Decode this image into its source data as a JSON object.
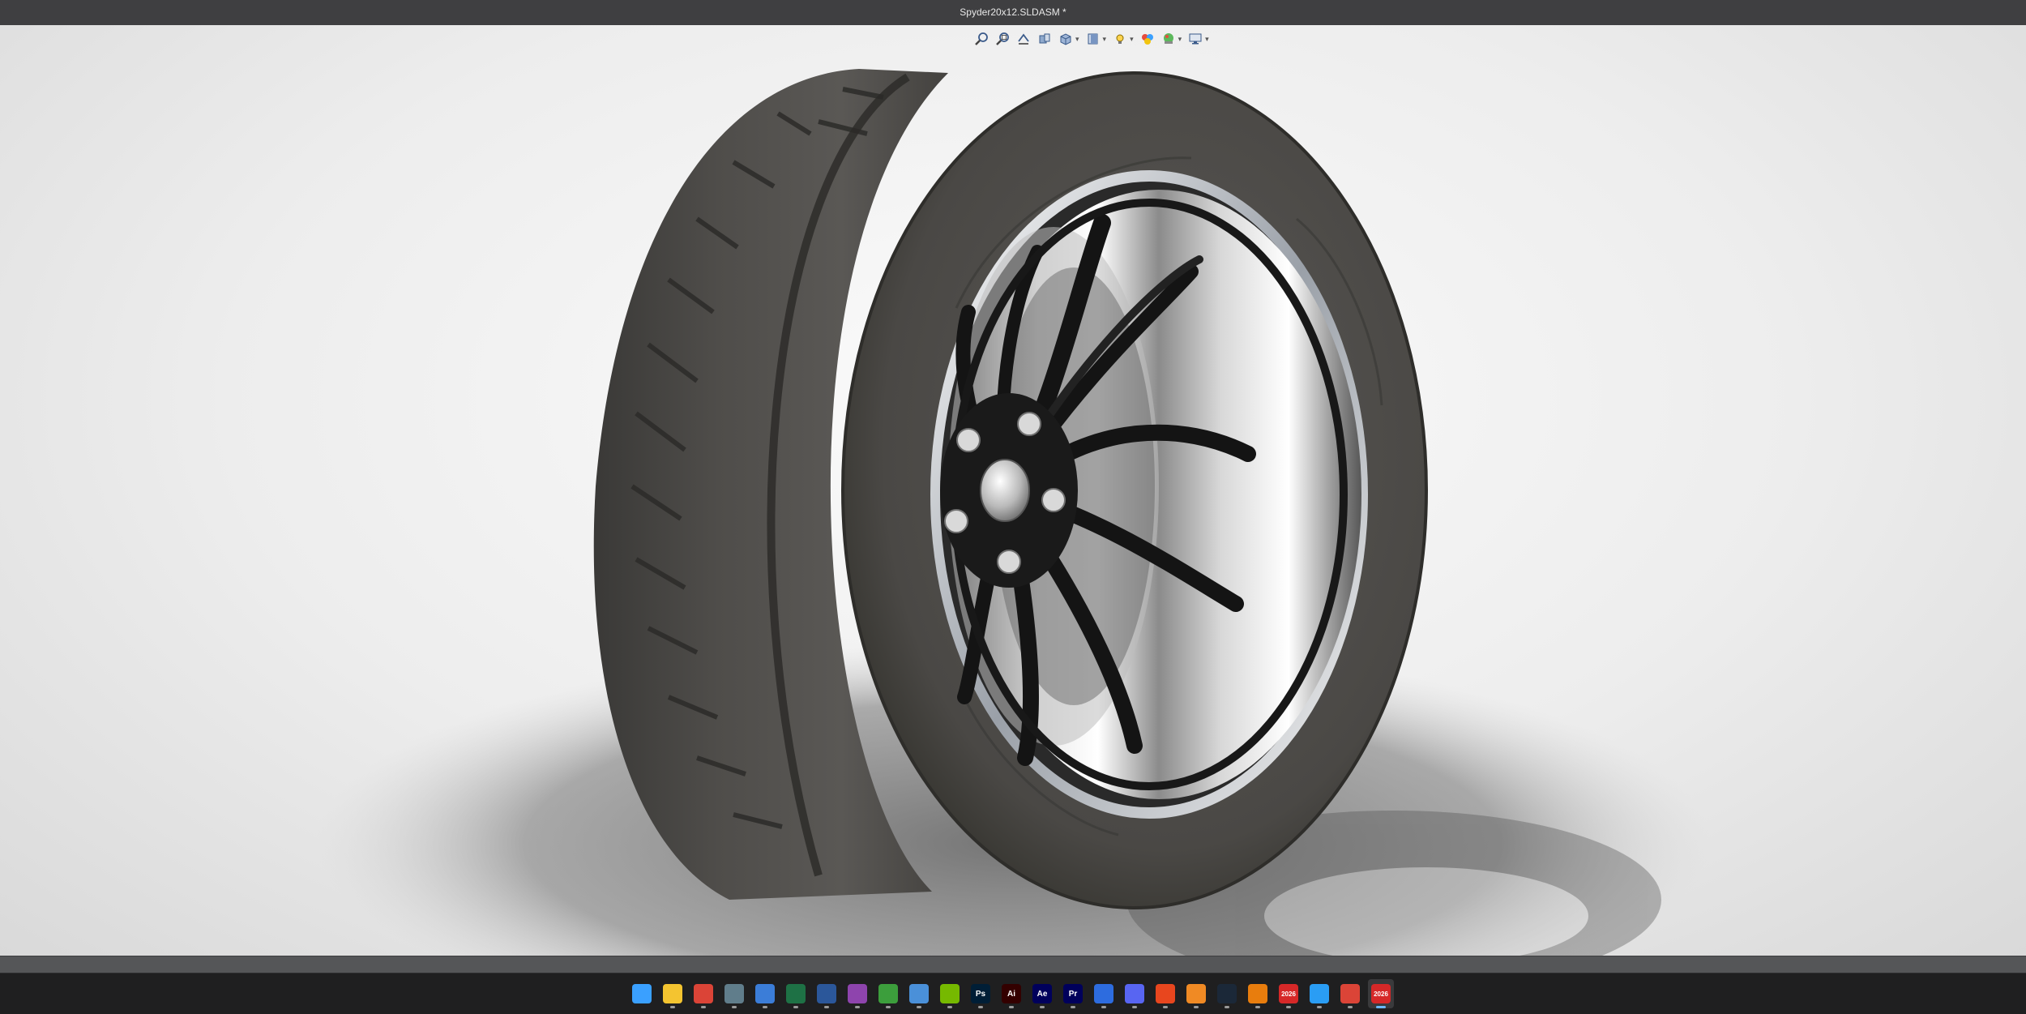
{
  "window": {
    "title": "Spyder20x12.SLDASM *"
  },
  "viewport": {
    "model_description": "3D rendered wheel assembly",
    "hud_tools": [
      {
        "name": "zoom-to-fit-icon",
        "has_dropdown": false
      },
      {
        "name": "zoom-to-area-icon",
        "has_dropdown": false
      },
      {
        "name": "previous-view-icon",
        "has_dropdown": false
      },
      {
        "name": "section-view-icon",
        "has_dropdown": false
      },
      {
        "name": "view-orientation-icon",
        "has_dropdown": true
      },
      {
        "name": "display-style-icon",
        "has_dropdown": true
      },
      {
        "name": "hide-show-items-icon",
        "has_dropdown": true
      },
      {
        "name": "edit-appearance-icon",
        "has_dropdown": false
      },
      {
        "name": "apply-scene-icon",
        "has_dropdown": true
      },
      {
        "name": "view-settings-icon",
        "has_dropdown": true
      }
    ]
  },
  "taskbar": {
    "apps": [
      {
        "name": "windows-start-icon",
        "color": "#3aa0ff",
        "label": ""
      },
      {
        "name": "file-explorer-icon",
        "color": "#f4c430",
        "label": ""
      },
      {
        "name": "chrome-icon",
        "color": "#db4437",
        "label": ""
      },
      {
        "name": "calculator-icon",
        "color": "#607d8b",
        "label": ""
      },
      {
        "name": "calendar-icon",
        "color": "#3b7dd8",
        "label": ""
      },
      {
        "name": "excel-icon",
        "color": "#1e7145",
        "label": ""
      },
      {
        "name": "word-icon",
        "color": "#2b579a",
        "label": ""
      },
      {
        "name": "screen-recorder-icon",
        "color": "#8e44ad",
        "label": ""
      },
      {
        "name": "xbox-icon",
        "color": "#3c9e3c",
        "label": ""
      },
      {
        "name": "phone-link-icon",
        "color": "#4a90d9",
        "label": ""
      },
      {
        "name": "nvidia-icon",
        "color": "#76b900",
        "label": ""
      },
      {
        "name": "photoshop-icon",
        "color": "#001e36",
        "label": "Ps"
      },
      {
        "name": "illustrator-icon",
        "color": "#330000",
        "label": "Ai"
      },
      {
        "name": "after-effects-icon",
        "color": "#00005b",
        "label": "Ae"
      },
      {
        "name": "premiere-icon",
        "color": "#00005b",
        "label": "Pr"
      },
      {
        "name": "messenger-icon",
        "color": "#2d6cdf",
        "label": ""
      },
      {
        "name": "discord-icon",
        "color": "#5865f2",
        "label": ""
      },
      {
        "name": "ea-app-icon",
        "color": "#e8461e",
        "label": ""
      },
      {
        "name": "fusion-icon",
        "color": "#f08a24",
        "label": ""
      },
      {
        "name": "steam-icon",
        "color": "#1b2838",
        "label": ""
      },
      {
        "name": "blender-icon",
        "color": "#e87d0d",
        "label": ""
      },
      {
        "name": "solidworks-2026-icon",
        "color": "#d62828",
        "label": "2026"
      },
      {
        "name": "3d-viewer-icon",
        "color": "#2a9df4",
        "label": ""
      },
      {
        "name": "chrome-profile-icon",
        "color": "#db4437",
        "label": ""
      },
      {
        "name": "solidworks-2026-active-icon",
        "color": "#d62828",
        "label": "2026",
        "active": true
      }
    ]
  }
}
